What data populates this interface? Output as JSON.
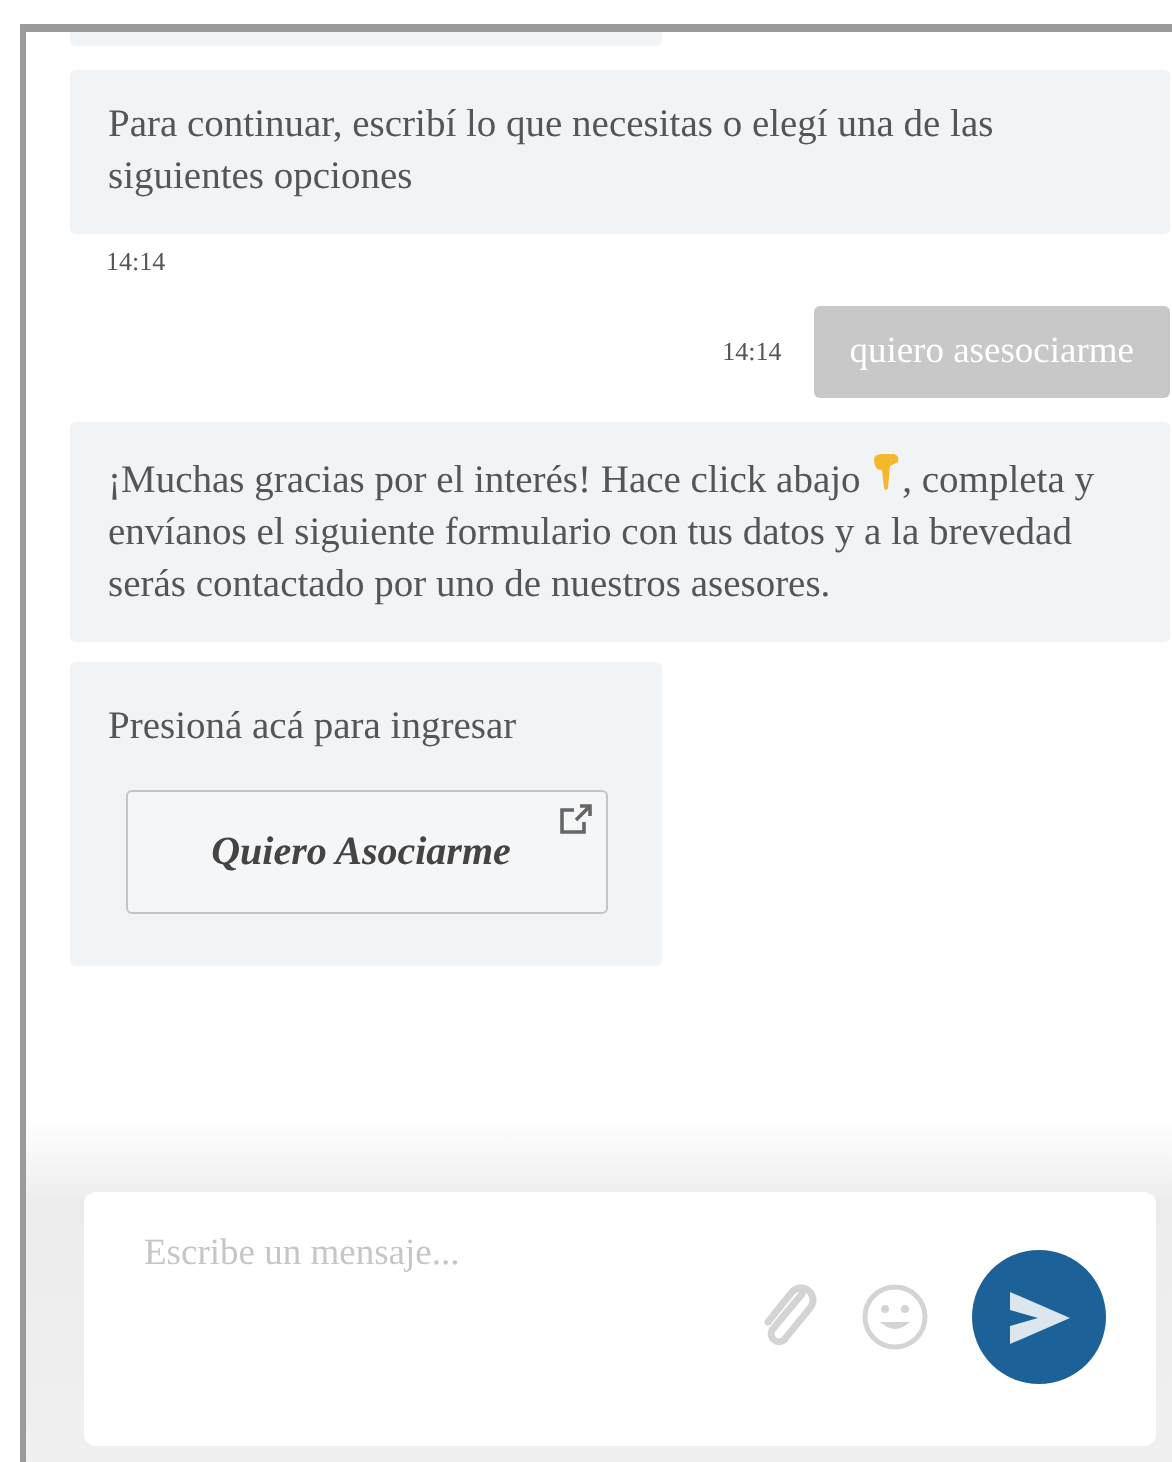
{
  "messages": [
    {
      "kind": "partial"
    },
    {
      "kind": "bot",
      "text": "Para continuar, escribí lo que necesitas o elegí una de las siguientes opciones",
      "time": "14:14"
    },
    {
      "kind": "user",
      "text": "quiero asesociarme",
      "time": "14:14"
    },
    {
      "kind": "bot_emoji",
      "text_before": "¡Muchas gracias por el interés! Hace click abajo",
      "text_after": ", completa y envíanos el siguiente formulario con tus datos y a la brevedad serás contactado por uno de nuestros asesores."
    },
    {
      "kind": "link_card",
      "text": "Presioná acá para ingresar",
      "button": "Quiero Asociarme"
    }
  ],
  "composer": {
    "placeholder": "Escribe un mensaje..."
  }
}
